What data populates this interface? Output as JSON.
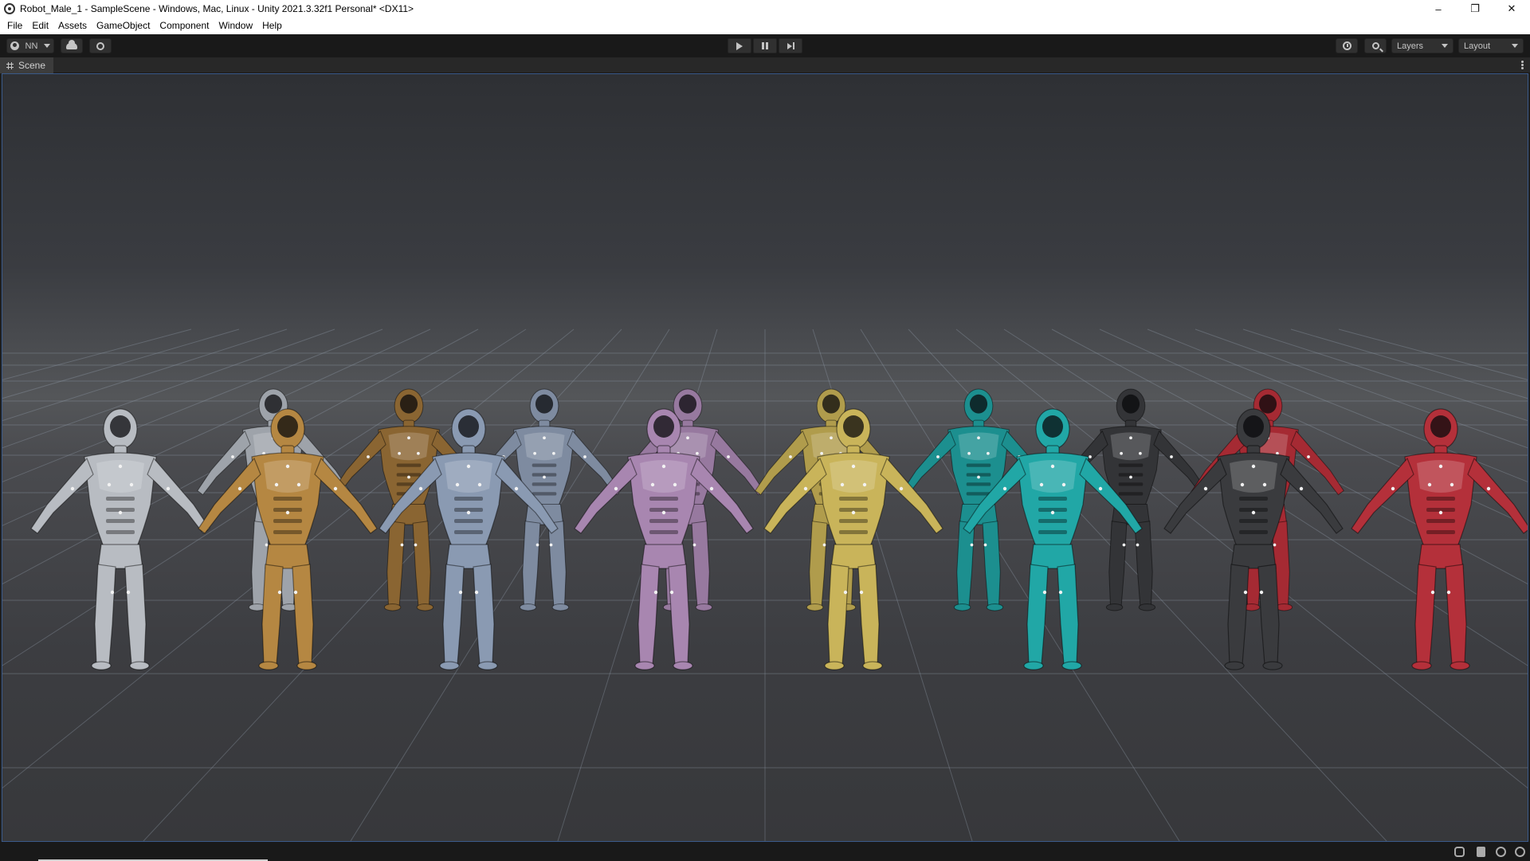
{
  "window": {
    "title": "Robot_Male_1 - SampleScene - Windows, Mac, Linux - Unity 2021.3.32f1 Personal* <DX11>",
    "controls": {
      "minimize": "–",
      "maximize": "❐",
      "close": "✕"
    }
  },
  "menu": [
    "File",
    "Edit",
    "Assets",
    "GameObject",
    "Component",
    "Window",
    "Help"
  ],
  "toolbar": {
    "account_label": "NN",
    "layers_label": "Layers",
    "layout_label": "Layout",
    "icons": [
      "account-icon",
      "cloud-icon",
      "collab-icon",
      "play-icon",
      "pause-icon",
      "step-icon",
      "history-icon",
      "search-icon"
    ]
  },
  "scene_tab": {
    "label": "Scene"
  },
  "scene": {
    "robots": [
      {
        "name": "silver-robot-front",
        "color": "#b8bcc2"
      },
      {
        "name": "silver-robot-back",
        "color": "#9ea3aa"
      },
      {
        "name": "bronze-robot-front",
        "color": "#b58742"
      },
      {
        "name": "bronze-robot-back",
        "color": "#8a6532"
      },
      {
        "name": "steel-blue-robot-front",
        "color": "#8a9ab2"
      },
      {
        "name": "steel-blue-robot-back",
        "color": "#7e8ba0"
      },
      {
        "name": "lilac-robot-front",
        "color": "#a886b0"
      },
      {
        "name": "lilac-robot-back",
        "color": "#97799f"
      },
      {
        "name": "gold-robot-front",
        "color": "#c9b45a"
      },
      {
        "name": "gold-robot-back",
        "color": "#b09c4c"
      },
      {
        "name": "teal-robot-front",
        "color": "#21a7a6"
      },
      {
        "name": "teal-robot-back",
        "color": "#1c8f8f"
      },
      {
        "name": "black-robot-front",
        "color": "#3a3b3e"
      },
      {
        "name": "black-robot-back",
        "color": "#333437"
      },
      {
        "name": "red-robot-front",
        "color": "#b4303a"
      },
      {
        "name": "red-robot-back",
        "color": "#a52a33"
      }
    ]
  },
  "statusbar": {
    "icons": [
      "debug-icon",
      "database-icon",
      "target-icon",
      "check-icon"
    ]
  }
}
